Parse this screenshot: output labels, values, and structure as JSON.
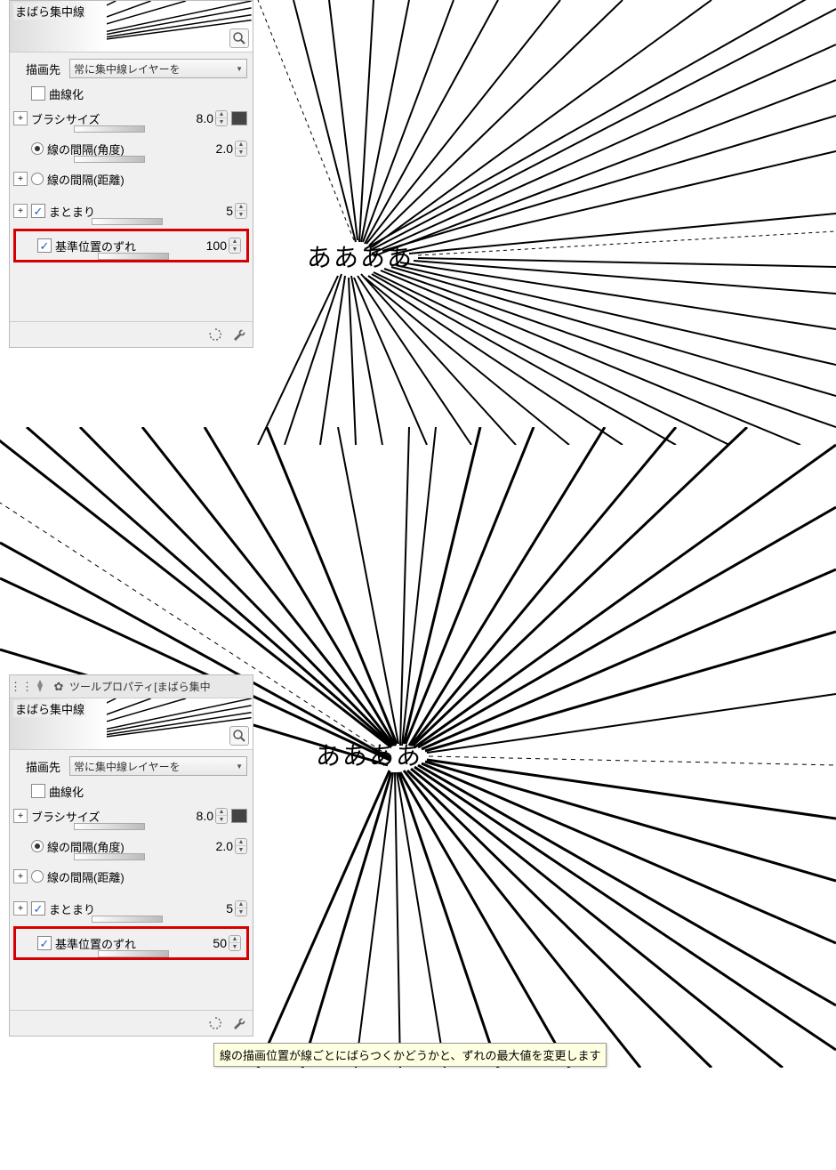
{
  "panel1": {
    "tool_name": "まばら集中線",
    "draw_target_label": "描画先",
    "draw_target_value": "常に集中線レイヤーを",
    "curve_label": "曲線化",
    "curve_checked": false,
    "brush_size_label": "ブラシサイズ",
    "brush_size_value": "8.0",
    "gap_angle_label": "線の間隔(角度)",
    "gap_angle_value": "2.0",
    "gap_angle_selected": true,
    "gap_distance_label": "線の間隔(距離)",
    "gap_distance_selected": false,
    "cluster_label": "まとまり",
    "cluster_checked": true,
    "cluster_value": "5",
    "offset_label": "基準位置のずれ",
    "offset_checked": true,
    "offset_value": "100"
  },
  "panel2": {
    "tab_title": "ツールプロパティ[まばら集中",
    "tool_name": "まばら集中線",
    "draw_target_label": "描画先",
    "draw_target_value": "常に集中線レイヤーを",
    "curve_label": "曲線化",
    "curve_checked": false,
    "brush_size_label": "ブラシサイズ",
    "brush_size_value": "8.0",
    "gap_angle_label": "線の間隔(角度)",
    "gap_angle_value": "2.0",
    "gap_angle_selected": true,
    "gap_distance_label": "線の間隔(距離)",
    "gap_distance_selected": false,
    "cluster_label": "まとまり",
    "cluster_checked": true,
    "cluster_value": "5",
    "offset_label": "基準位置のずれ",
    "offset_checked": true,
    "offset_value": "50"
  },
  "tooltip_text": "線の描画位置が線ごとにばらつくかどうかと、ずれの最大値を変更します",
  "aa_text": "ああああ",
  "colors": {
    "highlight": "#d60000",
    "panel_bg": "#f0f0f0"
  }
}
